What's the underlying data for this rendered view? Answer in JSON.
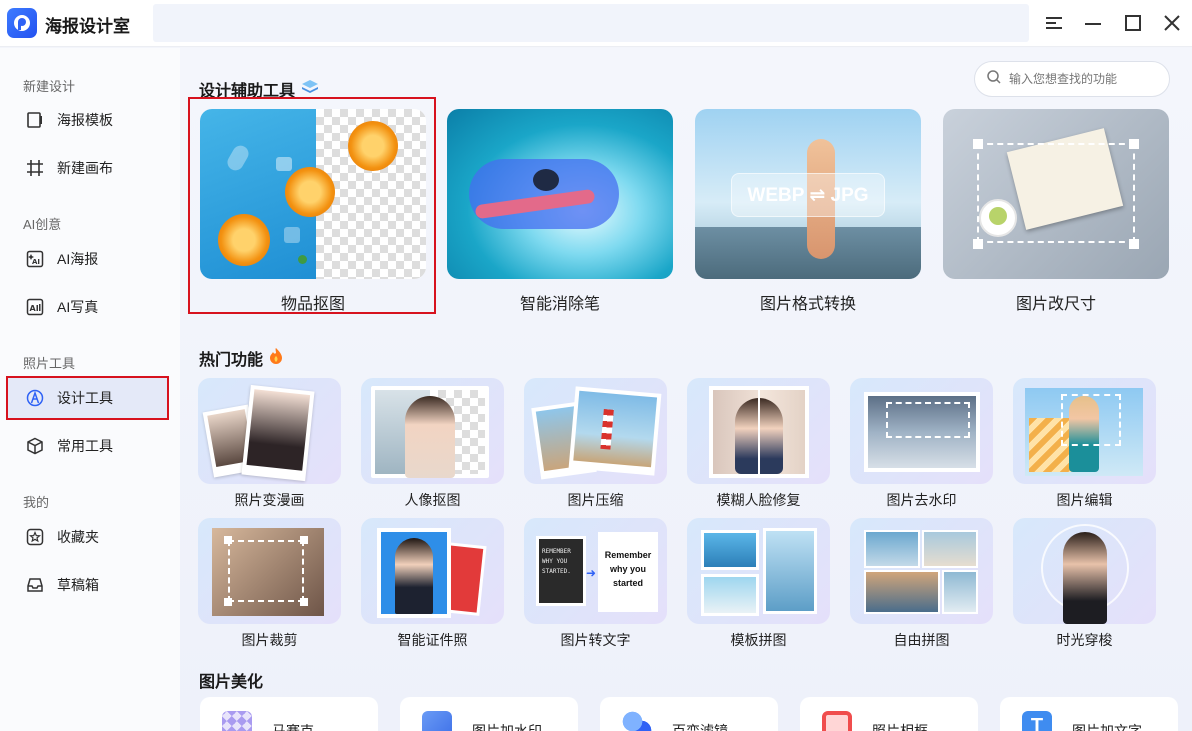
{
  "app": {
    "name": "海报设计室"
  },
  "sidebar": {
    "sections": [
      {
        "title": "新建设计",
        "items": [
          {
            "label": "海报模板",
            "icon": "template-icon"
          },
          {
            "label": "新建画布",
            "icon": "canvas-icon"
          }
        ]
      },
      {
        "title": "AI创意",
        "items": [
          {
            "label": "AI海报",
            "icon": "ai-poster-icon"
          },
          {
            "label": "AI写真",
            "icon": "ai-portrait-icon"
          }
        ]
      },
      {
        "title": "照片工具",
        "items": [
          {
            "label": "设计工具",
            "icon": "design-tool-icon",
            "active": true
          },
          {
            "label": "常用工具",
            "icon": "cube-icon"
          }
        ]
      },
      {
        "title": "我的",
        "items": [
          {
            "label": "收藏夹",
            "icon": "star-icon"
          },
          {
            "label": "草稿箱",
            "icon": "inbox-icon"
          }
        ]
      }
    ]
  },
  "search": {
    "placeholder": "输入您想查找的功能"
  },
  "design_tools": {
    "title": "设计辅助工具",
    "items": [
      {
        "label": "物品抠图"
      },
      {
        "label": "智能消除笔"
      },
      {
        "label": "图片格式转换",
        "badge": "WEBP ⇌ JPG"
      },
      {
        "label": "图片改尺寸"
      }
    ]
  },
  "hot": {
    "title": "热门功能",
    "items": [
      {
        "label": "照片变漫画"
      },
      {
        "label": "人像抠图"
      },
      {
        "label": "图片压缩"
      },
      {
        "label": "模糊人脸修复"
      },
      {
        "label": "图片去水印"
      },
      {
        "label": "图片编辑"
      },
      {
        "label": "图片裁剪"
      },
      {
        "label": "智能证件照"
      },
      {
        "label": "图片转文字",
        "before_text": "REMEMBER WHY YOU STARTED.",
        "after_text": "Remember why you started"
      },
      {
        "label": "模板拼图"
      },
      {
        "label": "自由拼图"
      },
      {
        "label": "时光穿梭"
      }
    ]
  },
  "beautify": {
    "title": "图片美化",
    "items": [
      {
        "label": "马赛克"
      },
      {
        "label": "图片加水印"
      },
      {
        "label": "百变滤镜"
      },
      {
        "label": "照片相框"
      },
      {
        "label": "图片加文字"
      }
    ]
  },
  "colors": {
    "accent": "#2f62f5",
    "selection": "#d7121e"
  }
}
